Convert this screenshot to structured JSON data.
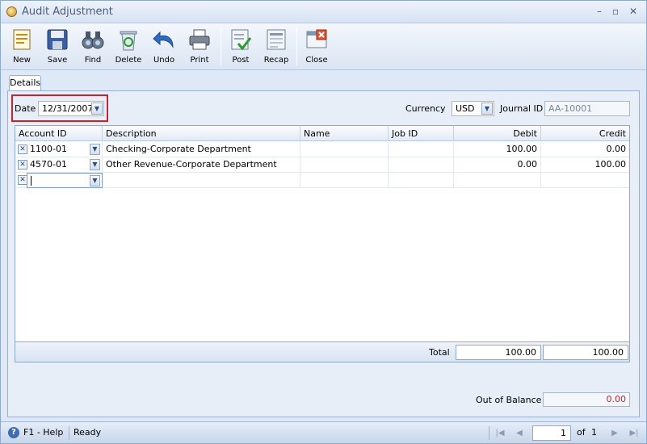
{
  "window": {
    "title": "Audit Adjustment",
    "minimize": "–",
    "restore": "▫",
    "close": "✕"
  },
  "toolbar": {
    "new": "New",
    "save": "Save",
    "find": "Find",
    "delete": "Delete",
    "undo": "Undo",
    "print": "Print",
    "post": "Post",
    "recap": "Recap",
    "close": "Close"
  },
  "tabs": {
    "details": "Details"
  },
  "form": {
    "date_label": "Date",
    "date_value": "12/31/2007",
    "currency_label": "Currency",
    "currency_value": "USD",
    "journal_label": "Journal ID",
    "journal_value": "AA-10001"
  },
  "grid": {
    "columns": {
      "account": "Account ID",
      "description": "Description",
      "name": "Name",
      "job": "Job ID",
      "debit": "Debit",
      "credit": "Credit"
    },
    "rows": [
      {
        "account": "1100-01",
        "description": "Checking-Corporate Department",
        "name": "",
        "job": "",
        "debit": "100.00",
        "credit": "0.00"
      },
      {
        "account": "4570-01",
        "description": "Other Revenue-Corporate Department",
        "name": "",
        "job": "",
        "debit": "0.00",
        "credit": "100.00"
      }
    ],
    "total_label": "Total",
    "total_debit": "100.00",
    "total_credit": "100.00"
  },
  "balance": {
    "label": "Out of Balance",
    "value": "0.00"
  },
  "status": {
    "help": "F1 - Help",
    "state": "Ready",
    "page": "1",
    "of_label": "of",
    "page_count": "1"
  },
  "icons": {
    "help": "?",
    "row_remove": "✕",
    "dropdown": "▼",
    "first": "|◀",
    "prev": "◀",
    "next": "▶",
    "last": "▶|"
  }
}
